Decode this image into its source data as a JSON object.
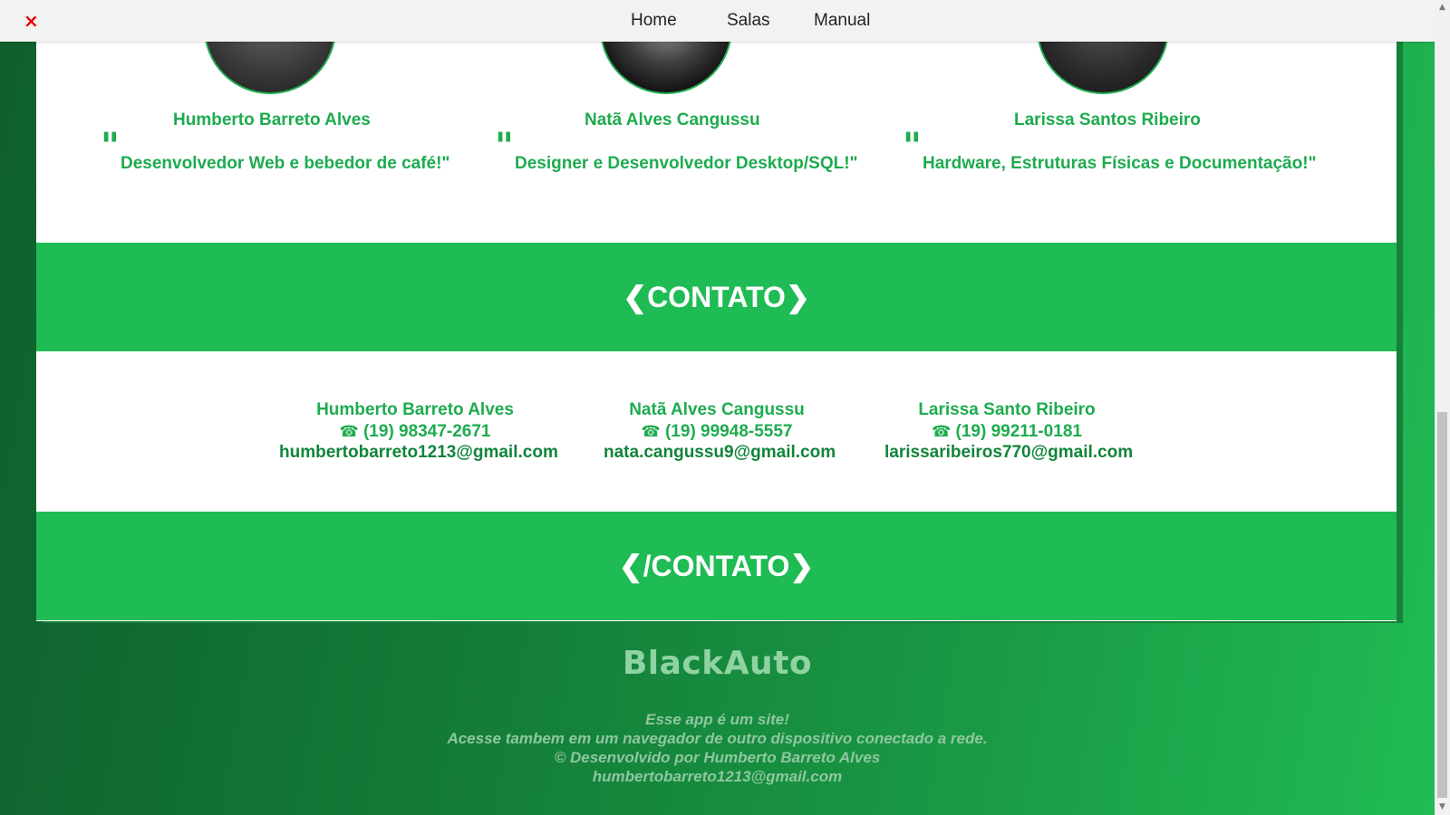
{
  "topbar": {
    "close_icon": "×",
    "nav": [
      "Home",
      "Salas",
      "Manual"
    ]
  },
  "team": [
    {
      "name": "Humberto Barreto Alves",
      "quote": "Desenvolvedor Web e bebedor de café!\""
    },
    {
      "name": "Natã Alves Cangussu",
      "quote": "Designer e Desenvolvedor Desktop/SQL!\""
    },
    {
      "name": "Larissa Santos Ribeiro",
      "quote": "Hardware, Estruturas Físicas e Documentação!\""
    }
  ],
  "quote_mark": "\"",
  "bands": {
    "open": "❮CONTATO❯",
    "close": "❮/CONTATO❯"
  },
  "contacts": [
    {
      "name": "Humberto Barreto Alves",
      "phone": "(19) 98347-2671",
      "email": "humbertobarreto1213@gmail.com"
    },
    {
      "name": "Natã Alves Cangussu",
      "phone": "(19) 99948-5557",
      "email": "nata.cangussu9@gmail.com"
    },
    {
      "name": "Larissa Santo Ribeiro",
      "phone": "(19) 99211-0181",
      "email": "larissaribeiros770@gmail.com"
    }
  ],
  "phone_icon": "☎",
  "footer": {
    "brand": "BlackAuto",
    "lines": [
      "Esse app é um site!",
      "Acesse tambem em um navegador de outro dispositivo conectado a rede.",
      "© Desenvolvido por Humberto Barreto Alves",
      "humbertobarreto1213@gmail.com"
    ]
  },
  "colors": {
    "accent_green": "#1eab4f",
    "band_green": "#1fbb54",
    "close_red": "#e60000"
  }
}
